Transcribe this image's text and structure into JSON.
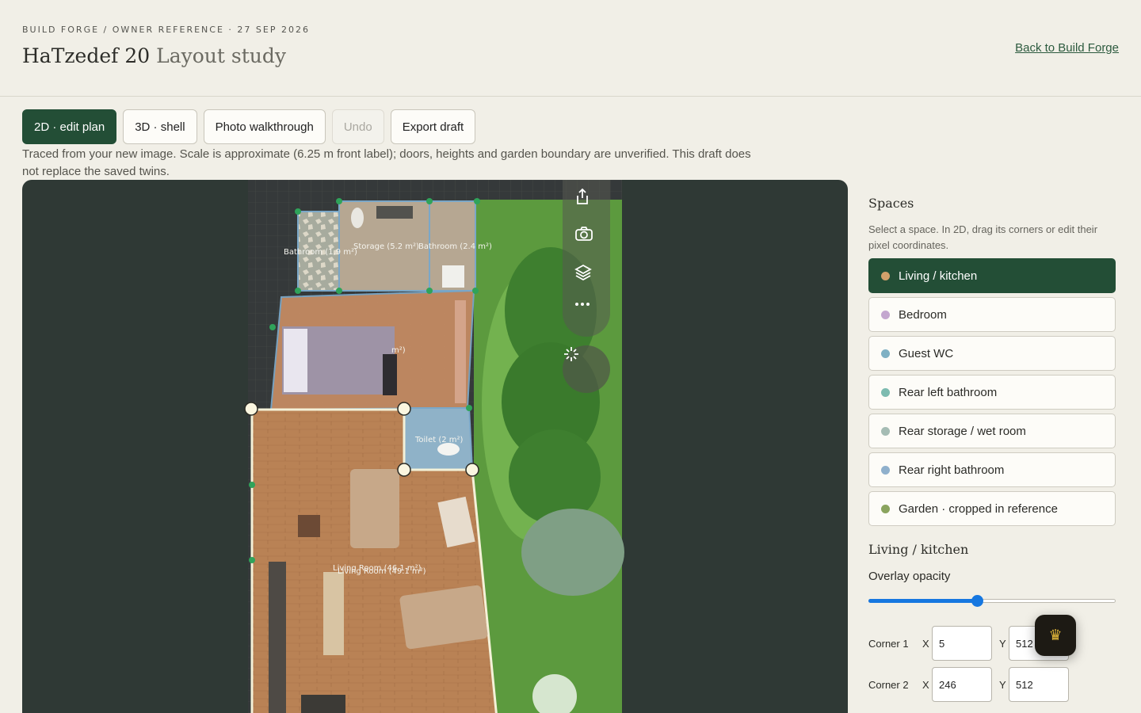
{
  "header": {
    "eyebrow": "BUILD FORGE / OWNER REFERENCE · 27 SEP 2026",
    "title": "HaTzedef 20",
    "subtitle": "Layout study",
    "back_link": "Back to Build Forge"
  },
  "toolbar": {
    "buttons": [
      {
        "label": "2D · edit plan",
        "active": true
      },
      {
        "label": "3D · shell"
      },
      {
        "label": "Photo walkthrough"
      },
      {
        "label": "Undo",
        "disabled": true
      },
      {
        "label": "Export draft"
      }
    ]
  },
  "note": "Traced from your new image. Scale is approximate (6.25 m front label); doors, heights and garden boundary are unverified. This draft does not replace the saved twins.",
  "plan": {
    "room_labels": [
      "Bathroom (1.9 m²)",
      "Storage (5.2 m²)",
      "Bathroom (2.4 m²)",
      "Toilet (2 m²)",
      "Living Room (46.1 m²)",
      "Living Room (49.1 m²)",
      "m²)"
    ],
    "tools": [
      "share-icon",
      "camera-icon",
      "layers-icon",
      "more-icon",
      "magic-wand-icon"
    ]
  },
  "panel": {
    "heading": "Spaces",
    "hint": "Select a space. In 2D, drag its corners or edit their pixel coordinates.",
    "spaces": [
      {
        "label": "Living / kitchen",
        "color": "#d3a06b",
        "active": true
      },
      {
        "label": "Bedroom",
        "color": "#c4a7cf"
      },
      {
        "label": "Guest WC",
        "color": "#7fb0c3"
      },
      {
        "label": "Rear left bathroom",
        "color": "#7dbbb0"
      },
      {
        "label": "Rear storage / wet room",
        "color": "#a5bcb4"
      },
      {
        "label": "Rear right bathroom",
        "color": "#8fb0cc"
      },
      {
        "label": "Garden · cropped in reference",
        "color": "#8aa45e"
      }
    ],
    "selected_heading": "Living / kitchen",
    "opacity_label": "Overlay opacity",
    "opacity_value": 0.44,
    "corners": [
      {
        "label": "Corner 1",
        "x_label": "X",
        "x": "5",
        "y_label": "Y",
        "y": "512"
      },
      {
        "label": "Corner 2",
        "x_label": "X",
        "x": "246",
        "y_label": "Y",
        "y": "512"
      }
    ]
  },
  "fab": {
    "icon": "crown-icon",
    "glyph": "♛"
  }
}
